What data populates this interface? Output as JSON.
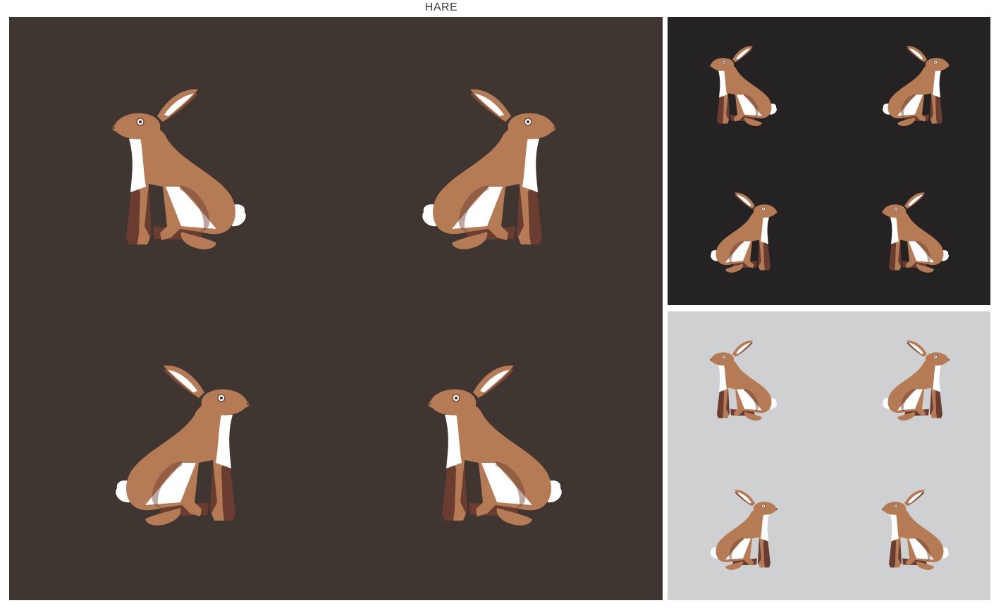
{
  "title": "HARE",
  "colors": {
    "main_background": "#3f3531",
    "dark_background": "#242222",
    "light_background": "#cfd0d2",
    "hare_body": "#b57b55",
    "hare_shadow": "#6b3d30",
    "hare_belly": "#ffffff",
    "hare_outline": "#7a4a36"
  },
  "panels": [
    {
      "name": "main-pattern-panel",
      "background": "main_background",
      "motif": "hare-icon",
      "count": 4
    },
    {
      "name": "dark-pattern-panel",
      "background": "dark_background",
      "motif": "hare-icon",
      "count": 4
    },
    {
      "name": "grey-pattern-panel",
      "background": "light_background",
      "motif": "hare-icon",
      "count": 4
    }
  ]
}
